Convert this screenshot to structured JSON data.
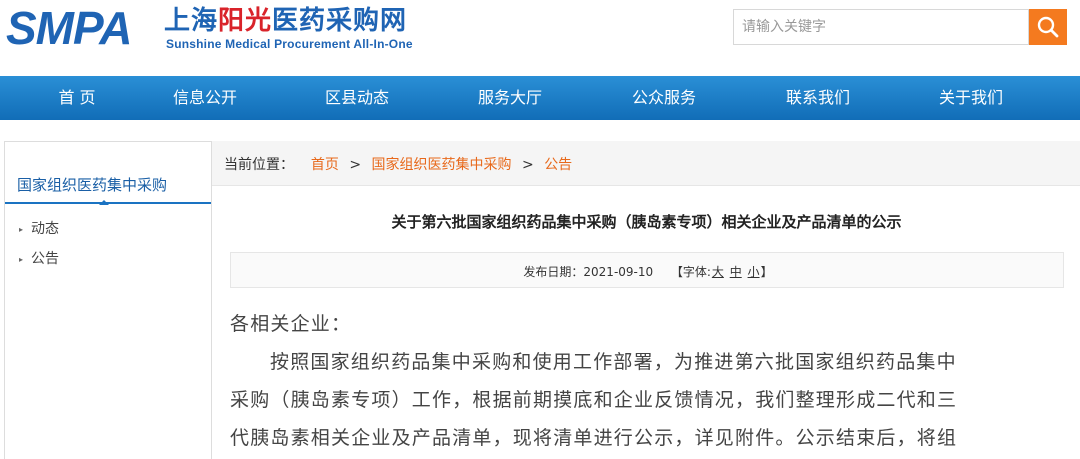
{
  "header": {
    "logo_text": "SMPA",
    "logo_cn_part1": "上海",
    "logo_cn_accent": "阳光",
    "logo_cn_part2": "医药采购网",
    "logo_en": "Sunshine Medical Procurement All-In-One",
    "search_placeholder": "请输入关键字",
    "search_icon": "search-icon"
  },
  "nav": {
    "items": [
      "首 页",
      "信息公开",
      "区县动态",
      "服务大厅",
      "公众服务",
      "联系我们",
      "关于我们"
    ]
  },
  "sidebar": {
    "title": "国家组织医药集中采购",
    "items": [
      "动态",
      "公告"
    ]
  },
  "breadcrumb": {
    "prefix": "当前位置：",
    "items": [
      "首页",
      "国家组织医药集中采购",
      "公告"
    ],
    "separator": ">"
  },
  "article": {
    "title": "关于第六批国家组织药品集中采购（胰岛素专项）相关企业及产品清单的公示",
    "publish_label": "发布日期：2021-09-10",
    "font_label_open": "【字体:",
    "font_large": "大",
    "font_medium": "中",
    "font_small": "小",
    "font_label_close": "】",
    "salutation": "各相关企业：",
    "paragraph_lines": [
      "按照国家组织药品集中采购和使用工作部署，为推进第六批国家组织药品集中",
      "采购（胰岛素专项）工作，根据前期摸底和企业反馈情况，我们整理形成二代和三",
      "代胰岛素相关企业及产品清单，现将清单进行公示，详见附件。公示结束后，将组"
    ]
  },
  "colors": {
    "brand_blue": "#1f64b4",
    "accent_red": "#d9232a",
    "nav_blue": "#1a7cc7",
    "link_orange": "#e8691b",
    "search_orange": "#f47a1f"
  }
}
